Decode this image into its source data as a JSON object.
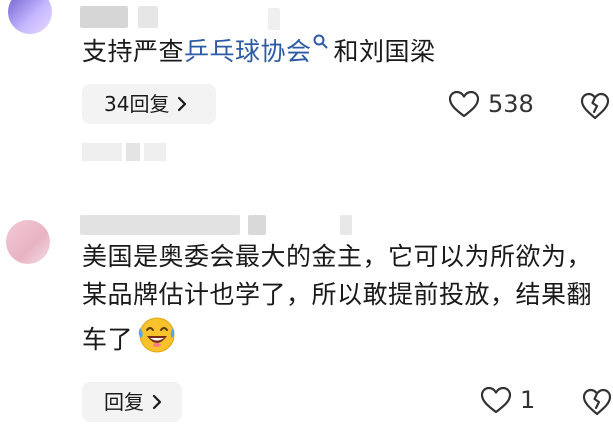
{
  "comments": [
    {
      "text_before": "支持严查",
      "link_text": "乒乓球协会",
      "text_after": "和刘国梁",
      "reply_label": "34回复",
      "like_count": "538"
    },
    {
      "text": "美国是奥委会最大的金主，它可以为所欲为，某品牌估计也学了，所以敢提前投放，结果翻车了",
      "reply_label": "回复",
      "like_count": "1"
    }
  ],
  "icons": {
    "like": "heart-outline-icon",
    "dislike": "broken-heart-icon",
    "chevron": "chevron-right-icon",
    "search": "search-icon",
    "emoji": "laughing-crying-emoji"
  },
  "colors": {
    "link": "#2c5aa3",
    "button_bg": "#f3f3f3"
  }
}
